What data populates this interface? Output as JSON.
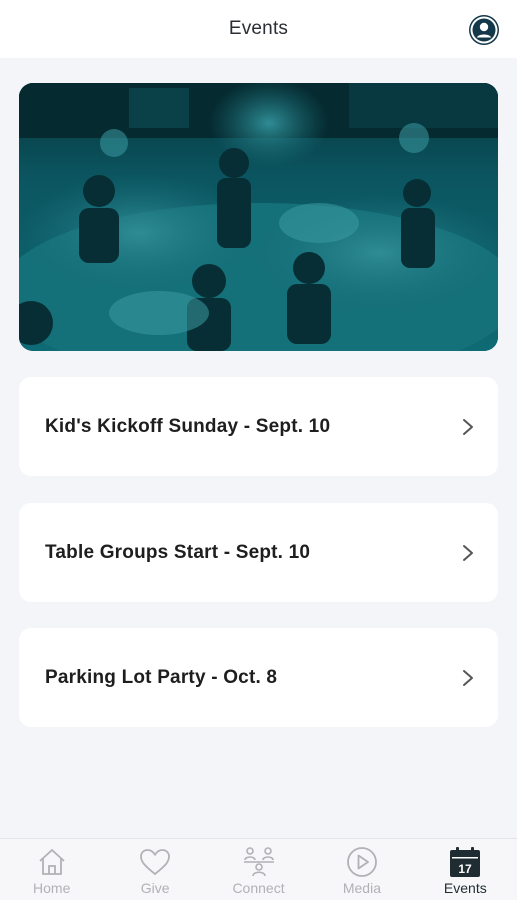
{
  "header": {
    "title": "Events"
  },
  "hero": {
    "image_description_icon": "kids-foam-party-photo"
  },
  "events": [
    {
      "title": "Kid's Kickoff Sunday - Sept. 10"
    },
    {
      "title": "Table Groups Start - Sept. 10"
    },
    {
      "title": "Parking Lot Party - Oct. 8"
    }
  ],
  "tabs": [
    {
      "label": "Home",
      "icon": "home-icon",
      "active": false
    },
    {
      "label": "Give",
      "icon": "heart-icon",
      "active": false
    },
    {
      "label": "Connect",
      "icon": "connect-icon",
      "active": false
    },
    {
      "label": "Media",
      "icon": "play-icon",
      "active": false
    },
    {
      "label": "Events",
      "icon": "calendar-icon",
      "active": true,
      "calendar_day": "17"
    }
  ],
  "colors": {
    "accent": "#13384a",
    "hero_tint": "#0b5560",
    "tab_inactive": "#b1b1b6",
    "tab_active": "#1f2d33"
  }
}
